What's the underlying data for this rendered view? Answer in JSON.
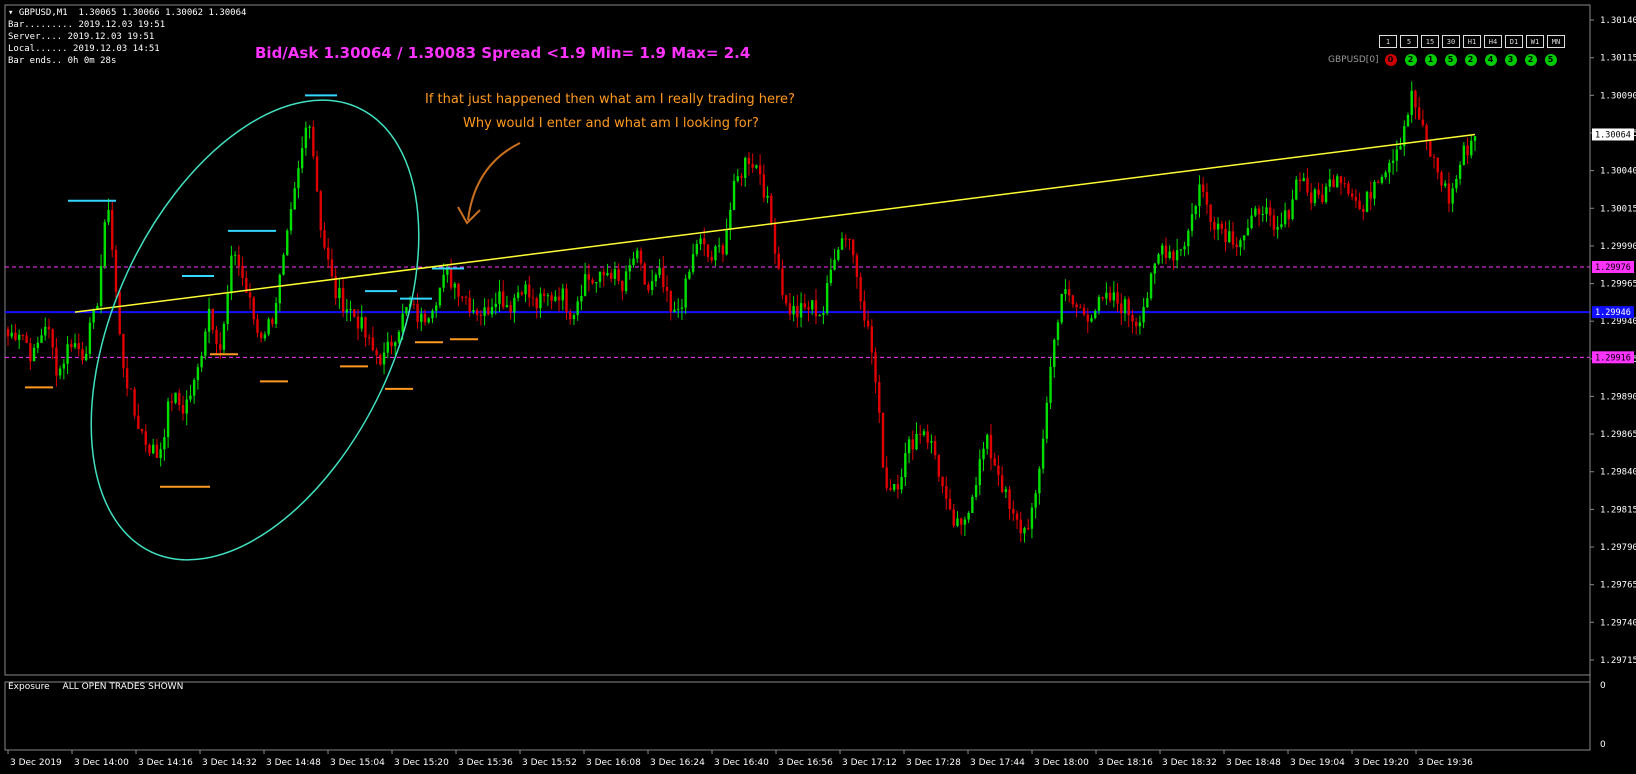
{
  "header": {
    "symbol_line": "GBPUSD,M1  1.30065 1.30066 1.30062 1.30064",
    "bar_line": "Bar......... 2019.12.03 19:51",
    "server_line": "Server.... 2019.12.03 19:51",
    "local_line": "Local...... 2019.12.03 14:51",
    "bar_ends_line": "Bar ends.. 0h 0m 28s"
  },
  "bid_ask_text": "Bid/Ask 1.30064 / 1.30083  Spread  <1.9  Min= 1.9  Max= 2.4",
  "annotation": {
    "line1": "If that just happened then what am I really trading here?",
    "line2": "Why would I enter and what am I looking for?"
  },
  "timeframes": [
    "1",
    "5",
    "15",
    "30",
    "H1",
    "H4",
    "D1",
    "W1",
    "MN"
  ],
  "trend_panel": {
    "label": "GBPUSD[0]",
    "values": [
      "0",
      "2",
      "1",
      "5",
      "2",
      "4",
      "3",
      "2",
      "5"
    ],
    "colors": [
      "#cc0000",
      "#00cc00",
      "#00cc00",
      "#00cc00",
      "#00cc00",
      "#00cc00",
      "#00cc00",
      "#00cc00",
      "#00cc00"
    ]
  },
  "exposure": {
    "title": "Exposure",
    "subtitle": "ALL OPEN TRADES SHOWN",
    "axis_top": "0",
    "axis_bottom": "0"
  },
  "colors": {
    "up": "#00e000",
    "down": "#e00000",
    "trendline": "#ffff33",
    "level": "#1010ff",
    "dashed": "#ff33ff",
    "ellipse": "#40e0c0",
    "annotation": "#ff9a1f"
  },
  "chart_data": {
    "type": "candlestick",
    "symbol": "GBPUSD",
    "timeframe": "M1",
    "ylim": [
      1.29705,
      1.3015
    ],
    "y_ticks": [
      "1.30140",
      "1.30115",
      "1.30090",
      "1.30065",
      "1.30040",
      "1.30015",
      "1.29990",
      "1.29965",
      "1.29940",
      "1.29915",
      "1.29890",
      "1.29865",
      "1.29840",
      "1.29815",
      "1.29790",
      "1.29765",
      "1.29740",
      "1.29715"
    ],
    "x_ticks": [
      "3 Dec 2019",
      "3 Dec 14:00",
      "3 Dec 14:16",
      "3 Dec 14:32",
      "3 Dec 14:48",
      "3 Dec 15:04",
      "3 Dec 15:20",
      "3 Dec 15:36",
      "3 Dec 15:52",
      "3 Dec 16:08",
      "3 Dec 16:24",
      "3 Dec 16:40",
      "3 Dec 16:56",
      "3 Dec 17:12",
      "3 Dec 17:28",
      "3 Dec 17:44",
      "3 Dec 18:00",
      "3 Dec 18:16",
      "3 Dec 18:32",
      "3 Dec 18:48",
      "3 Dec 19:04",
      "3 Dec 19:20",
      "3 Dec 19:36"
    ],
    "price_labels": [
      {
        "value": 1.30064,
        "text": "1.30064",
        "kind": "current"
      },
      {
        "value": 1.29976,
        "text": "1.29976",
        "kind": "magenta"
      },
      {
        "value": 1.29946,
        "text": "1.29946",
        "kind": "blue"
      },
      {
        "value": 1.29916,
        "text": "1.29916",
        "kind": "magenta"
      }
    ],
    "horizontal_levels": [
      {
        "value": 1.29946,
        "style": "solid",
        "color": "blue"
      },
      {
        "value": 1.29976,
        "style": "dashed",
        "color": "magenta"
      },
      {
        "value": 1.29916,
        "style": "dashed",
        "color": "magenta"
      }
    ],
    "trendline": {
      "from": 1.29946,
      "to": 1.30064
    },
    "keypoints": [
      1.2993,
      1.29935,
      1.29915,
      1.2994,
      1.29905,
      1.29928,
      1.29918,
      1.29946,
      1.3002,
      1.2992,
      1.2988,
      1.2986,
      1.2985,
      1.2989,
      1.29882,
      1.299,
      1.2995,
      1.2992,
      1.2999,
      1.2996,
      1.2993,
      1.2994,
      1.2998,
      1.3003,
      1.3008,
      1.3,
      1.2996,
      1.2995,
      1.2994,
      1.2992,
      1.29915,
      1.29935,
      1.2995,
      1.2994,
      1.29955,
      1.2997,
      1.29962,
      1.2995,
      1.29945,
      1.2996,
      1.2995,
      1.29965,
      1.2995,
      1.29955,
      1.2996,
      1.29945,
      1.2997,
      1.29965,
      1.29975,
      1.2996,
      1.29985,
      1.2996,
      1.2997,
      1.2994,
      1.2996,
      1.29995,
      1.2998,
      1.2999,
      1.3003,
      1.3005,
      1.3004,
      1.3,
      1.2995,
      1.29945,
      1.2995,
      1.29945,
      1.2999,
      1.3,
      1.2996,
      1.29915,
      1.2983,
      1.29835,
      1.2986,
      1.2987,
      1.2985,
      1.2981,
      1.298,
      1.2983,
      1.2986,
      1.2984,
      1.2981,
      1.298,
      1.2982,
      1.299,
      1.2996,
      1.2995,
      1.29945,
      1.2995,
      1.29955,
      1.2995,
      1.2994,
      1.2996,
      1.2999,
      1.29985,
      1.29995,
      1.3003,
      1.3001,
      1.3,
      1.29995,
      1.3,
      1.3002,
      1.29995,
      1.3001,
      1.3004,
      1.3002,
      1.30025,
      1.3004,
      1.3003,
      1.3001,
      1.30035,
      1.30045,
      1.3006,
      1.3009,
      1.3006,
      1.3004,
      1.3002,
      1.3005,
      1.30064
    ],
    "annotated_highs": [
      1.3002,
      1.2997,
      1.3,
      1.3009,
      1.2996,
      1.29955,
      1.29975
    ],
    "annotated_lows": [
      1.29896,
      1.2983,
      1.29918,
      1.299,
      1.2991,
      1.29895,
      1.29926,
      1.29928
    ],
    "grid": false
  }
}
